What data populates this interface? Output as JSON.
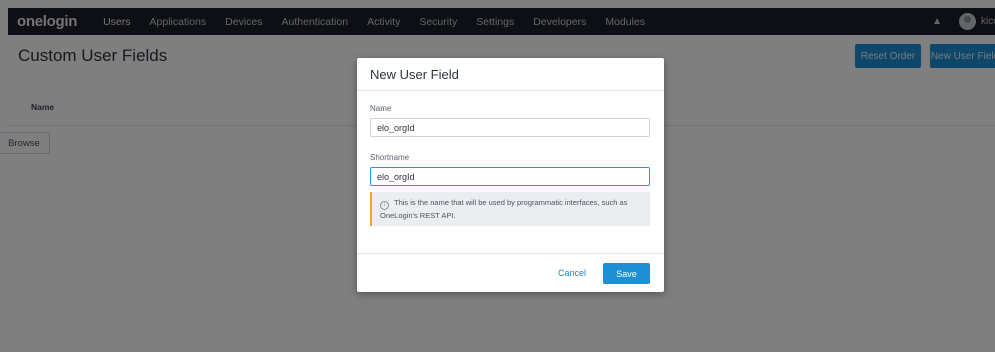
{
  "header": {
    "logo": "onelogin",
    "nav": [
      "Users",
      "Applications",
      "Devices",
      "Authentication",
      "Activity",
      "Security",
      "Settings",
      "Developers",
      "Modules"
    ],
    "user_name": "kico"
  },
  "page": {
    "title": "Custom User Fields",
    "reset_order_label": "Reset Order",
    "new_field_label": "New User Field",
    "table_column_name": "Name",
    "browse_label": "Browse"
  },
  "modal": {
    "title": "New User Field",
    "name_label": "Name",
    "name_value": "elo_orgId",
    "shortname_label": "Shortname",
    "shortname_value": "elo_orgId",
    "hint_line1": "This is the name that will be used by programmatic interfaces, such as",
    "hint_line2": "OneLogin's REST API.",
    "cancel_label": "Cancel",
    "save_label": "Save"
  },
  "colors": {
    "nav_background": "#1c1f2a",
    "primary_button": "#1c8fd5",
    "hint_accent": "#f0a33b"
  }
}
